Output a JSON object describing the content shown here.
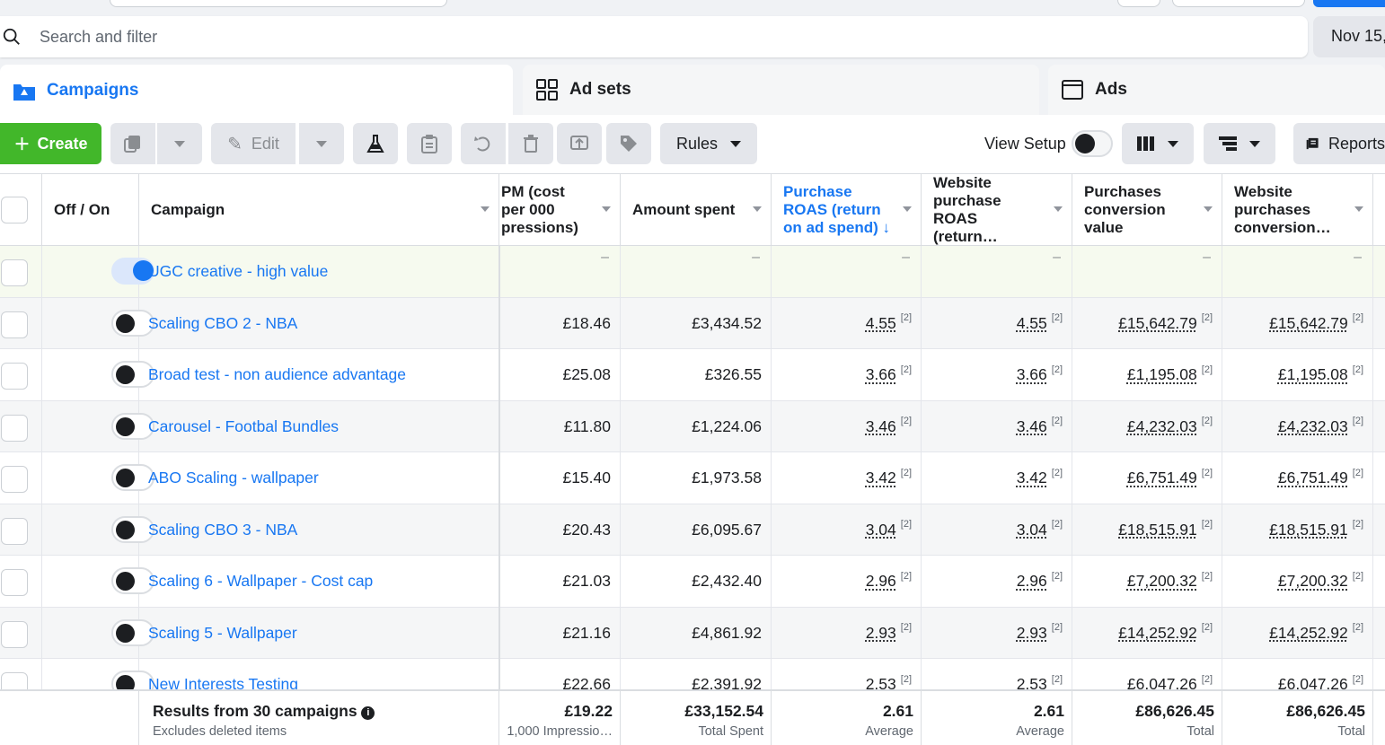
{
  "search": {
    "placeholder": "Search and filter"
  },
  "date_range": {
    "label": "Nov 15,"
  },
  "tabs": [
    {
      "label": "Campaigns",
      "icon": "folder-icon"
    },
    {
      "label": "Ad sets",
      "icon": "grid-icon"
    },
    {
      "label": "Ads",
      "icon": "ad-icon"
    }
  ],
  "toolbar": {
    "create_label": "Create",
    "edit_label": "Edit",
    "rules_label": "Rules",
    "view_setup_label": "View Setup",
    "reports_label": "Reports"
  },
  "table": {
    "headers": {
      "off_on": "Off / On",
      "campaign": "Campaign",
      "cpm": "PM (cost per 000 pressions)",
      "amount_spent": "Amount spent",
      "purchase_roas": "Purchase ROAS (return on ad spend) ↓",
      "website_purchase_roas": "Website purchase ROAS (return…",
      "purchases_conversion_value": "Purchases conversion value",
      "website_purchases_conversion": "Website purchases conversion…"
    },
    "footnote": "[2]",
    "dash": "–",
    "rows": [
      {
        "name": "UGC creative - high value",
        "on": true,
        "cpm": "",
        "spent": "",
        "roas": "",
        "wroas": "",
        "pcv": "",
        "wpcv": ""
      },
      {
        "name": "Scaling CBO 2 - NBA",
        "on": false,
        "cpm": "£18.46",
        "spent": "£3,434.52",
        "roas": "4.55",
        "wroas": "4.55",
        "pcv": "£15,642.79",
        "wpcv": "£15,642.79"
      },
      {
        "name": "Broad test - non audience advantage",
        "on": false,
        "cpm": "£25.08",
        "spent": "£326.55",
        "roas": "3.66",
        "wroas": "3.66",
        "pcv": "£1,195.08",
        "wpcv": "£1,195.08"
      },
      {
        "name": "Carousel - Footbal Bundles",
        "on": false,
        "cpm": "£11.80",
        "spent": "£1,224.06",
        "roas": "3.46",
        "wroas": "3.46",
        "pcv": "£4,232.03",
        "wpcv": "£4,232.03"
      },
      {
        "name": "ABO Scaling - wallpaper",
        "on": false,
        "cpm": "£15.40",
        "spent": "£1,973.58",
        "roas": "3.42",
        "wroas": "3.42",
        "pcv": "£6,751.49",
        "wpcv": "£6,751.49"
      },
      {
        "name": "Scaling CBO 3 - NBA",
        "on": false,
        "cpm": "£20.43",
        "spent": "£6,095.67",
        "roas": "3.04",
        "wroas": "3.04",
        "pcv": "£18,515.91",
        "wpcv": "£18,515.91"
      },
      {
        "name": "Scaling 6 - Wallpaper - Cost cap",
        "on": false,
        "cpm": "£21.03",
        "spent": "£2,432.40",
        "roas": "2.96",
        "wroas": "2.96",
        "pcv": "£7,200.32",
        "wpcv": "£7,200.32"
      },
      {
        "name": "Scaling 5 - Wallpaper",
        "on": false,
        "cpm": "£21.16",
        "spent": "£4,861.92",
        "roas": "2.93",
        "wroas": "2.93",
        "pcv": "£14,252.92",
        "wpcv": "£14,252.92"
      },
      {
        "name": "New Interests Testing",
        "on": false,
        "cpm": "£22.66",
        "spent": "£2,391.92",
        "roas": "2.53",
        "wroas": "2.53",
        "pcv": "£6,047.26",
        "wpcv": "£6,047.26"
      }
    ],
    "footer": {
      "title": "Results from 30 campaigns",
      "subtitle": "Excludes deleted items",
      "cpm": "£19.22",
      "cpm_sub": "1,000 Impressio…",
      "spent": "£33,152.54",
      "spent_sub": "Total Spent",
      "roas": "2.61",
      "roas_sub": "Average",
      "wroas": "2.61",
      "wroas_sub": "Average",
      "pcv": "£86,626.45",
      "pcv_sub": "Total",
      "wpcv": "£86,626.45",
      "wpcv_sub": "Total"
    }
  },
  "colors": {
    "accent": "#1877f2",
    "create": "#42b72a"
  }
}
